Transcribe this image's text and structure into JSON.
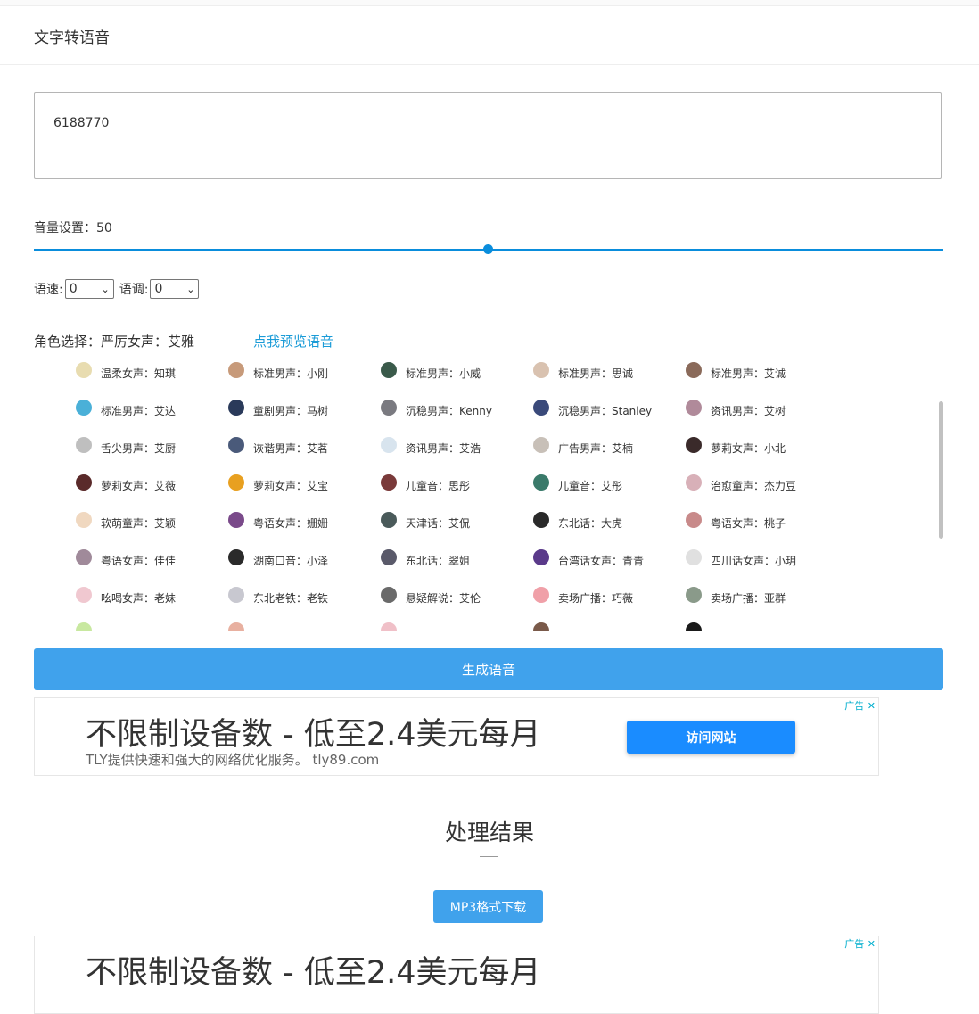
{
  "header": {
    "title": "文字转语音"
  },
  "textbox": {
    "value": "6188770"
  },
  "volume": {
    "label": "音量设置：50",
    "value": 50
  },
  "speed": {
    "label": "语速:",
    "value": "0"
  },
  "pitch": {
    "label": "语调:",
    "value": "0"
  },
  "role": {
    "label": "角色选择：严厉女声：艾雅",
    "preview_link": "点我预览语音"
  },
  "voices": [
    [
      "温柔女声：知琪",
      "标准男声：小刚",
      "标准男声：小威",
      "标准男声：思诚",
      "标准男声：艾诚"
    ],
    [
      "标准男声：艾达",
      "童剧男声：马树",
      "沉稳男声：Kenny",
      "沉稳男声：Stanley",
      "资讯男声：艾树"
    ],
    [
      "舌尖男声：艾厨",
      "诙谐男声：艾茗",
      "资讯男声：艾浩",
      "广告男声：艾楠",
      "萝莉女声：小北"
    ],
    [
      "萝莉女声：艾薇",
      "萝莉女声：艾宝",
      "儿童音：思彤",
      "儿童音：艾彤",
      "治愈童声：杰力豆"
    ],
    [
      "软萌童声：艾颖",
      "粤语女声：姗姗",
      "天津话：艾侃",
      "东北话：大虎",
      "粤语女声：桃子"
    ],
    [
      "粤语女声：佳佳",
      "湖南口音：小泽",
      "东北话：翠姐",
      "台湾话女声：青青",
      "四川话女声：小玥"
    ],
    [
      "吆喝女声：老妹",
      "东北老铁：老铁",
      "悬疑解说：艾伦",
      "卖场广播：巧薇",
      "卖场广播：亚群"
    ]
  ],
  "avatar_colors": [
    [
      "#e8dcb0",
      "#c79a7a",
      "#3a5a4a",
      "#d9c2b0",
      "#8a6a5a"
    ],
    [
      "#4ab0d8",
      "#2a3a5a",
      "#7a7a80",
      "#3a4a7a",
      "#b08a9a"
    ],
    [
      "#bfbfbf",
      "#4a5a7a",
      "#d8e4ee",
      "#c8c0b8",
      "#3a2a2a"
    ],
    [
      "#5a2a2a",
      "#e8a020",
      "#7a3a3a",
      "#3a7a6a",
      "#d8b0b8"
    ],
    [
      "#f0d8c0",
      "#7a4a8a",
      "#4a5a5a",
      "#2a2a2a",
      "#c88a8a"
    ],
    [
      "#a08a9a",
      "#2a2a2a",
      "#5a5a6a",
      "#5a3a8a",
      "#e0e0e0"
    ],
    [
      "#f0c8d0",
      "#c8c8d0",
      "#6a6a6a",
      "#f0a0a8",
      "#8a9a8a"
    ]
  ],
  "partial_avatar_colors": [
    "#c8e8a0",
    "#e8b0a0",
    "#f0c0c8",
    "#7a5a4a",
    "#1a1a1a"
  ],
  "generate_button": "生成语音",
  "ad": {
    "headline": "不限制设备数 - 低至2.4美元每月",
    "sub": "TLY提供快速和强大的网络优化服务。 tly89.com",
    "button": "访问网站",
    "tag": "广告 ✕"
  },
  "result": {
    "title": "处理结果",
    "download_button": "MP3格式下载"
  }
}
